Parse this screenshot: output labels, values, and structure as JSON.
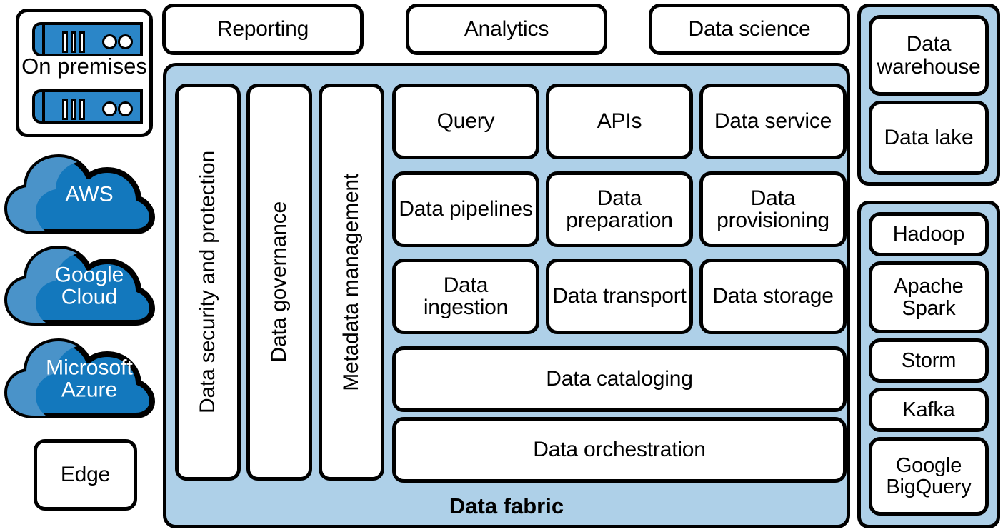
{
  "left_column": {
    "on_premises": {
      "label": "On premises",
      "icon": "server-rack-icon",
      "server_count": 2
    },
    "clouds": [
      {
        "label": "AWS",
        "icon": "cloud-icon"
      },
      {
        "label": "Google Cloud",
        "icon": "cloud-icon"
      },
      {
        "label": "Microsoft Azure",
        "icon": "cloud-icon"
      }
    ],
    "edge": {
      "label": "Edge"
    }
  },
  "top_row": [
    {
      "label": "Reporting"
    },
    {
      "label": "Analytics"
    },
    {
      "label": "Data science"
    }
  ],
  "fabric": {
    "title": "Data fabric",
    "vertical_columns": [
      {
        "label": "Data security and protection"
      },
      {
        "label": "Data governance"
      },
      {
        "label": "Metadata management"
      }
    ],
    "grid": [
      [
        {
          "label": "Query"
        },
        {
          "label": "APIs"
        },
        {
          "label": "Data service"
        }
      ],
      [
        {
          "label": "Data pipelines"
        },
        {
          "label": "Data preparation"
        },
        {
          "label": "Data provisioning"
        }
      ],
      [
        {
          "label": "Data ingestion"
        },
        {
          "label": "Data transport"
        },
        {
          "label": "Data storage"
        }
      ]
    ],
    "wide_bars": [
      {
        "label": "Data cataloging"
      },
      {
        "label": "Data orchestration"
      }
    ]
  },
  "right_column": {
    "storage_group": [
      {
        "label": "Data warehouse"
      },
      {
        "label": "Data lake"
      }
    ],
    "technology_group": [
      {
        "label": "Hadoop"
      },
      {
        "label": "Apache Spark"
      },
      {
        "label": "Storm"
      },
      {
        "label": "Kafka"
      },
      {
        "label": "Google BigQuery"
      }
    ]
  },
  "colors": {
    "fabric_fill": "#aed0e8",
    "cloud_fill": "#1378bd",
    "cloud_highlight": "#4a93c9",
    "server_fill": "#2b86c8",
    "outline": "#000000",
    "card_fill": "#ffffff"
  }
}
